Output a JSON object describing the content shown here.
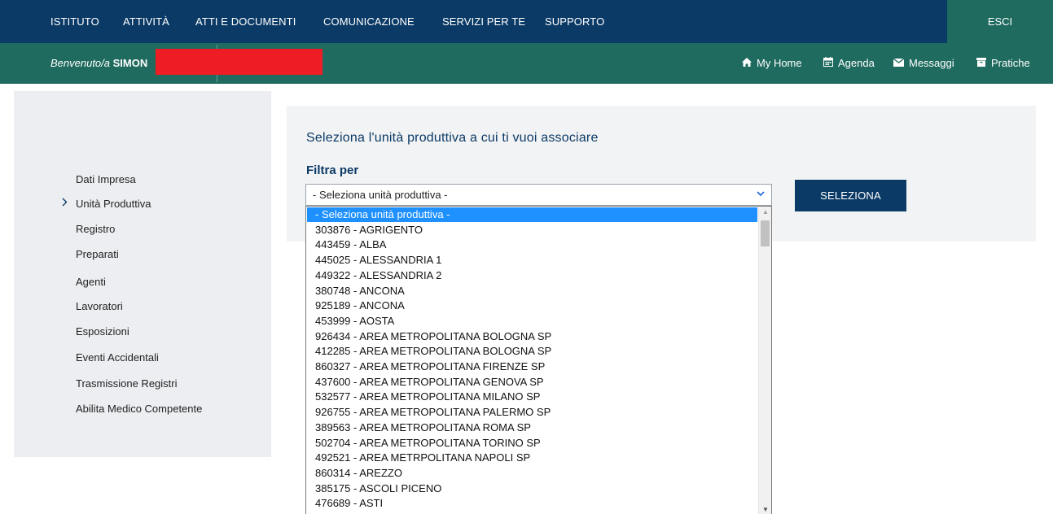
{
  "topnav": {
    "items": [
      {
        "label": "ISTITUTO"
      },
      {
        "label": "ATTIVITÀ"
      },
      {
        "label": "ATTI E DOCUMENTI"
      },
      {
        "label": "COMUNICAZIONE"
      },
      {
        "label": "SERVIZI PER TE"
      },
      {
        "label": "SUPPORTO"
      }
    ],
    "logout_label": "ESCI"
  },
  "welcome": {
    "greeting": "Benvenuto/a",
    "user_name_visible": "SIMON",
    "quicklinks": [
      {
        "label": "My Home",
        "icon": "home-icon"
      },
      {
        "label": "Agenda",
        "icon": "calendar-icon"
      },
      {
        "label": "Messaggi",
        "icon": "envelope-icon"
      },
      {
        "label": "Pratiche",
        "icon": "archive-icon"
      }
    ]
  },
  "sidebar": {
    "items": [
      {
        "label": "Dati Impresa",
        "active": false
      },
      {
        "label": "Unità Produttiva",
        "active": true
      },
      {
        "label": "Registro",
        "active": false
      },
      {
        "label": "Preparati",
        "active": false
      },
      {
        "label": "Agenti",
        "active": false
      },
      {
        "label": "Lavoratori",
        "active": false
      },
      {
        "label": "Esposizioni",
        "active": false
      },
      {
        "label": "Eventi Accidentali",
        "active": false
      },
      {
        "label": "Trasmissione Registri",
        "active": false
      },
      {
        "label": "Abilita Medico Competente",
        "active": false
      }
    ]
  },
  "main": {
    "title": "Seleziona l'unità produttiva a cui ti vuoi associare",
    "filter_label": "Filtra per",
    "select_value": "- Seleziona unità produttiva -",
    "submit_label": "SELEZIONA",
    "options": [
      "- Seleziona unità produttiva -",
      "303876 - AGRIGENTO",
      "443459 - ALBA",
      "445025 - ALESSANDRIA 1",
      "449322 - ALESSANDRIA 2",
      "380748 - ANCONA",
      "925189 - ANCONA",
      "453999 - AOSTA",
      "926434 - AREA METROPOLITANA BOLOGNA SP",
      "412285 - AREA METROPOLITANA BOLOGNA SP",
      "860327 - AREA METROPOLITANA FIRENZE SP",
      "437600 - AREA METROPOLITANA GENOVA SP",
      "532577 - AREA METROPOLITANA MILANO SP",
      "926755 - AREA METROPOLITANA PALERMO SP",
      "389563 - AREA METROPOLITANA ROMA SP",
      "502704 - AREA METROPOLITANA TORINO SP",
      "492521 - AREA METRPOLITANA NAPOLI SP",
      "860314 - AREZZO",
      "385175 - ASCOLI PICENO",
      "476689 - ASTI"
    ],
    "selected_index": 0
  },
  "colors": {
    "nav_blue": "#0b3a66",
    "teal": "#1f6b5f",
    "highlight": "#1e90ff",
    "redaction": "#ee1c24"
  }
}
